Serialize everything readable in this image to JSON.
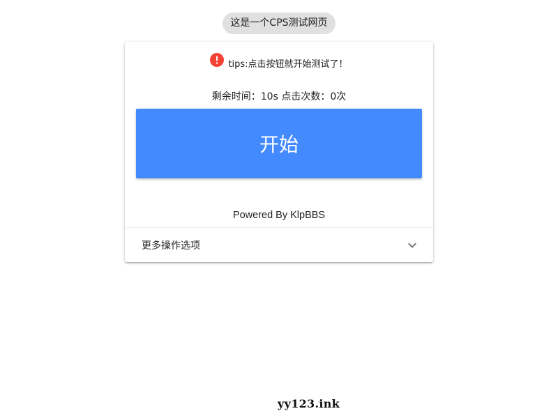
{
  "header": {
    "title": "这是一个CPS测试网页"
  },
  "card": {
    "tips": {
      "icon": "alert-circle-icon",
      "text": "tips:点击按钮就开始测试了！"
    },
    "status": {
      "text": "剩余时间：10s 点击次数：0次"
    },
    "start_button": {
      "label": "开始"
    },
    "powered_by": "Powered By KlpBBS",
    "expansion": {
      "label": "更多操作选项",
      "icon": "chevron-down-icon"
    }
  },
  "watermark": "yy123.ink",
  "colors": {
    "accent": "#448aff",
    "alert": "#f44336",
    "chip_bg": "#e0e0e0"
  }
}
